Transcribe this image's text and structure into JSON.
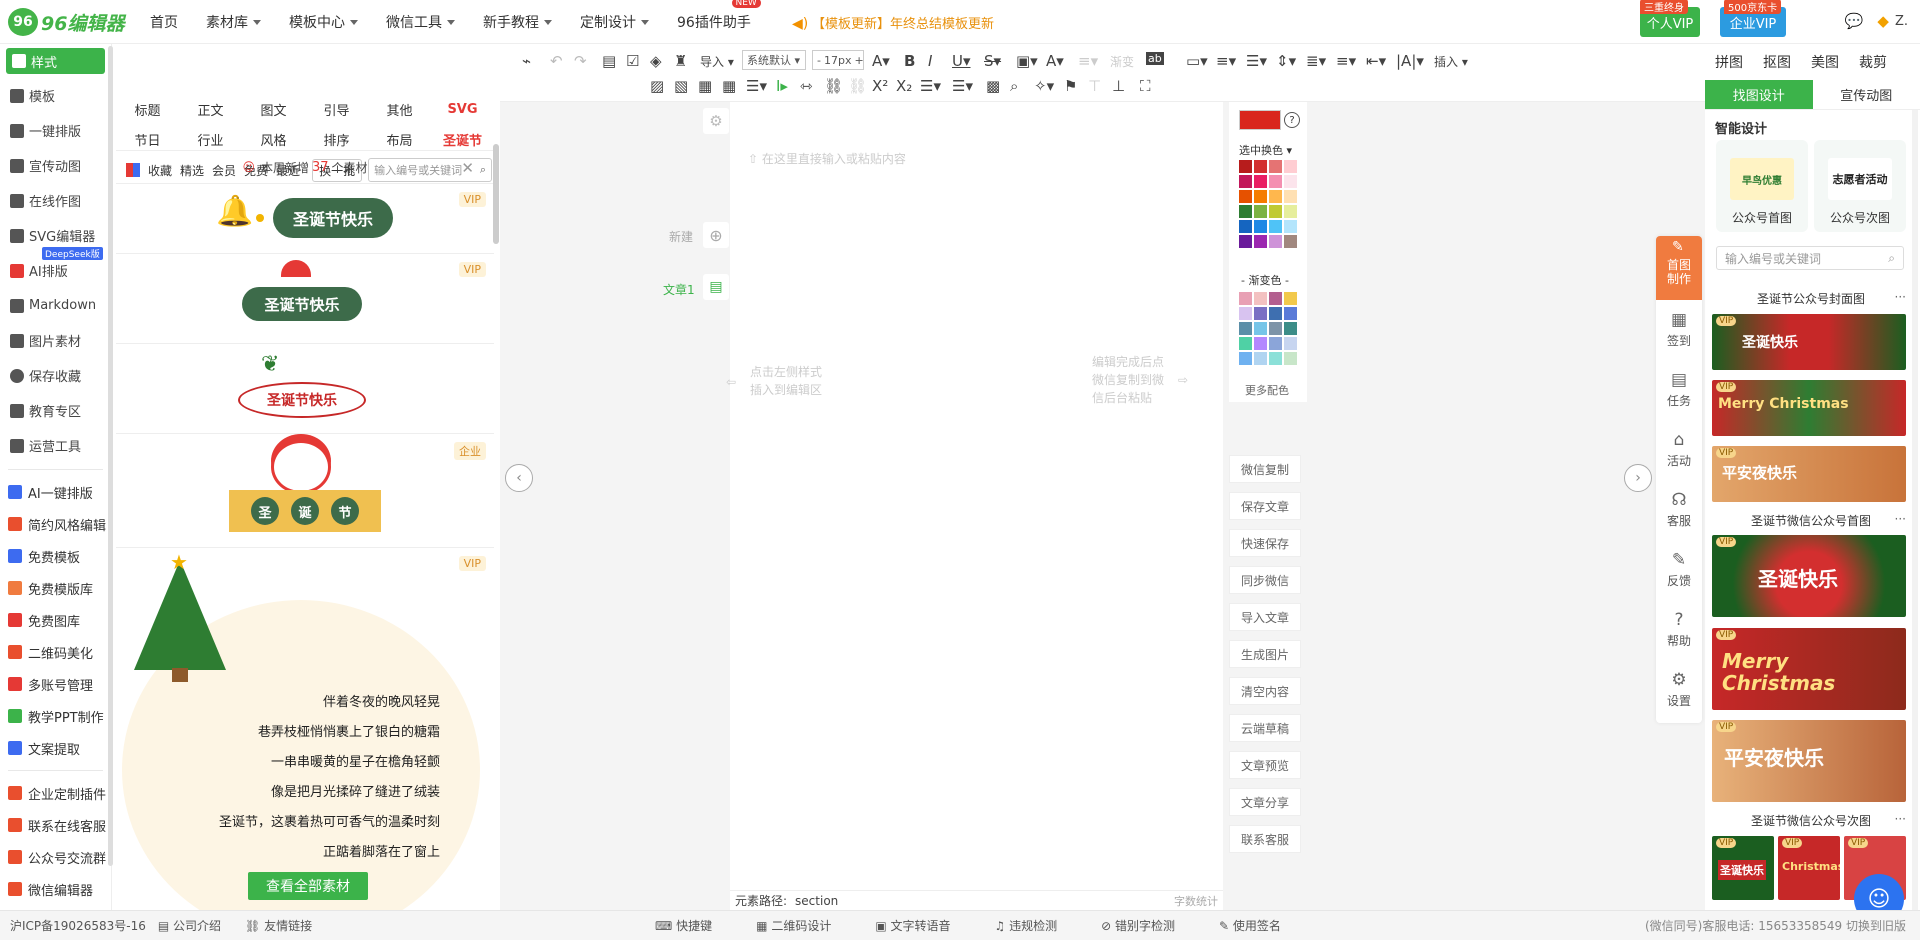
{
  "logo": {
    "mark": "96",
    "text": "96编辑器"
  },
  "topnav": [
    {
      "label": "首页",
      "caret": false
    },
    {
      "label": "素材库",
      "caret": true
    },
    {
      "label": "模板中心",
      "caret": true
    },
    {
      "label": "微信工具",
      "caret": true
    },
    {
      "label": "新手教程",
      "caret": true
    },
    {
      "label": "定制设计",
      "caret": true
    },
    {
      "label": "96插件助手",
      "caret": false,
      "badge": "NEW"
    }
  ],
  "announcement": "【模板更新】年终总结模板更新",
  "vip": {
    "personal": {
      "label": "个人VIP",
      "tag": "三重终身",
      "color": "#3cb34a"
    },
    "enterprise": {
      "label": "企业VIP",
      "tag": "500京东卡",
      "color": "#2c9be0"
    }
  },
  "user": {
    "name": "Z."
  },
  "leftnav": {
    "primary": [
      {
        "label": "样式",
        "active": true
      },
      {
        "label": "模板"
      },
      {
        "label": "一键排版"
      },
      {
        "label": "宣传动图"
      },
      {
        "label": "在线作图"
      },
      {
        "label": "SVG编辑器"
      },
      {
        "label": "AI排版",
        "tag": "DeepSeek版"
      },
      {
        "label": "Markdown"
      },
      {
        "label": "图片素材"
      },
      {
        "label": "保存收藏"
      },
      {
        "label": "教育专区"
      },
      {
        "label": "运营工具"
      }
    ],
    "secondary": [
      {
        "label": "AI一键排版",
        "color": "#3d6bf0"
      },
      {
        "label": "简约风格编辑",
        "color": "#e94f2e"
      },
      {
        "label": "免费模板",
        "color": "#3d6bf0"
      },
      {
        "label": "免费模版库",
        "color": "#f07b3f"
      },
      {
        "label": "免费图库",
        "color": "#e53935"
      },
      {
        "label": "二维码美化",
        "color": "#e94f2e"
      },
      {
        "label": "多账号管理",
        "color": "#e53935"
      },
      {
        "label": "教学PPT制作",
        "color": "#3cb34a"
      },
      {
        "label": "文案提取",
        "color": "#3d6bf0"
      }
    ],
    "tertiary": [
      {
        "label": "企业定制插件",
        "color": "#e94f2e"
      },
      {
        "label": "联系在线客服",
        "color": "#e94f2e"
      },
      {
        "label": "公众号交流群",
        "color": "#e94f2e"
      },
      {
        "label": "微信编辑器",
        "color": "#e94f2e"
      }
    ]
  },
  "categories": {
    "row1": [
      "标题",
      "正文",
      "图文",
      "引导",
      "其他",
      "SVG"
    ],
    "row2": [
      "节日",
      "行业",
      "风格",
      "排序",
      "布局",
      "圣诞节"
    ],
    "filters": [
      "收藏",
      "精选",
      "会员",
      "免费",
      "最近"
    ],
    "swap": "换一批",
    "search_placeholder": "输入编号或关键词"
  },
  "notice": {
    "pre": "本周新增",
    "count": "37",
    "post": "个素材"
  },
  "templates": [
    {
      "badge": "VIP",
      "text": "圣诞节快乐"
    },
    {
      "badge": "VIP",
      "text": "圣诞节快乐"
    },
    {
      "badge": "",
      "text": "圣诞节快乐"
    },
    {
      "badge": "企业",
      "chars": [
        "圣",
        "诞",
        "节"
      ]
    },
    {
      "badge": "VIP",
      "poem": [
        "伴着冬夜的晚风轻晃",
        "巷弄枝桠悄悄裹上了银白的糖霜",
        "一串串暖黄的星子在檐角轻颤",
        "像是把月光揉碎了缝进了绒装",
        "圣诞节，这裹着热可可香气的温柔时刻",
        "正踮着脚落在了窗上"
      ]
    }
  ],
  "see_all": "查看全部素材",
  "toolbar": {
    "import": "导入",
    "font": "系统默认",
    "size": "17px",
    "gradient": "渐变",
    "insert": "插入"
  },
  "editor": {
    "placeholder": "在这里直接输入或粘贴内容",
    "hint_left": [
      "点击左侧样式",
      "插入到编辑区"
    ],
    "hint_right": [
      "编辑完成后点",
      "微信复制到微",
      "信后台粘贴"
    ],
    "new_label": "新建",
    "article_label": "文章1",
    "path_label": "元素路径:",
    "path_value": "section",
    "word_count": "字数统计"
  },
  "colorpanel": {
    "current": "#d9251d",
    "label": "选中换色",
    "gradient_label": "- 渐变色 -",
    "more": "更多配色",
    "solid": [
      [
        "#b71c1c",
        "#d32f2f",
        "#e57373",
        "#ffcdd2"
      ],
      [
        "#c2185b",
        "#e91e63",
        "#f48fb1",
        "#fce4ec"
      ],
      [
        "#e65100",
        "#f57c00",
        "#ffb74d",
        "#ffe0b2"
      ],
      [
        "#2e7d32",
        "#7cb342",
        "#c0ca33",
        "#e6ee9c"
      ],
      [
        "#1565c0",
        "#1e88e5",
        "#4fc3f7",
        "#b3e5fc"
      ],
      [
        "#6a1b9a",
        "#9c27b0",
        "#ce93d8",
        "#a1887f"
      ]
    ],
    "gradient": [
      [
        "#e8a0b4",
        "#f3c1c1",
        "#b35f8f",
        "#f2c94c"
      ],
      [
        "#d8c3f0",
        "#7a6fc4",
        "#3e6fb0",
        "#5a7bd8"
      ],
      [
        "#5b8fa8",
        "#76c5e8",
        "#7d94a8",
        "#3c8d88"
      ],
      [
        "#4fd1a5",
        "#b388ff",
        "#8ba5d9",
        "#c7d5f0"
      ],
      [
        "#6fb1f0",
        "#b0d4f1",
        "#8be0d8",
        "#c8e6c9"
      ]
    ]
  },
  "actions": [
    "微信复制",
    "保存文章",
    "快速保存",
    "同步微信",
    "导入文章",
    "生成图片",
    "清空内容",
    "云端草稿",
    "文章预览",
    "文章分享",
    "联系客服"
  ],
  "right": {
    "tabs": [
      "拼图",
      "抠图",
      "美图",
      "裁剪"
    ],
    "subtabs": [
      "找图设计",
      "宣传动图"
    ],
    "smart_title": "智能设计",
    "smart": [
      {
        "label": "公众号首图",
        "art": "早鸟优惠"
      },
      {
        "label": "公众号次图",
        "art": "志愿者活动"
      }
    ],
    "search_placeholder": "输入编号或关键词",
    "sections": [
      "圣诞节公众号封面图",
      "圣诞节微信公众号首图",
      "圣诞节微信公众号次图"
    ],
    "img_texts": [
      "圣诞快乐",
      "Merry Christmas",
      "平安夜快乐",
      "圣诞快乐",
      "Merry Christmas",
      "平安夜快乐",
      "圣诞快乐",
      "Christmas"
    ],
    "vip": "VIP"
  },
  "sidetools": [
    "首图制作",
    "签到",
    "任务",
    "活动",
    "客服",
    "反馈",
    "帮助",
    "设置"
  ],
  "footer": {
    "left": [
      "沪ICP备19026583号-16",
      "公司介绍",
      "友情链接"
    ],
    "center": [
      "快捷键",
      "二维码设计",
      "文字转语音",
      "违规检测",
      "错别字检测",
      "使用签名"
    ],
    "right": "(微信同号)客服电话: 15653358549   切换到旧版"
  }
}
